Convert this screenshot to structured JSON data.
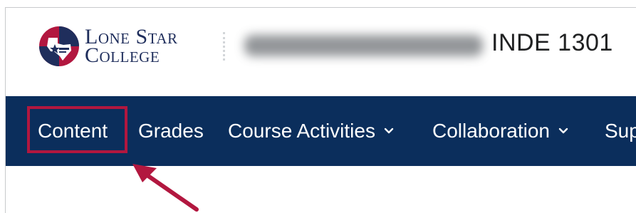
{
  "header": {
    "logo": {
      "line1": "Lone Star",
      "line2": "College",
      "mark_text": "Lone Star College"
    },
    "course_name_blurred": "",
    "course_code": "INDE 1301"
  },
  "nav": {
    "items": [
      {
        "label": "Content",
        "has_dropdown": false,
        "highlighted": true
      },
      {
        "label": "Grades",
        "has_dropdown": false
      },
      {
        "label": "Course Activities",
        "has_dropdown": true
      },
      {
        "label": "Collaboration",
        "has_dropdown": true
      },
      {
        "label": "Sup",
        "has_dropdown": false
      }
    ]
  },
  "annotation": {
    "highlight_color": "#b2173f",
    "target": "Content"
  },
  "colors": {
    "navbar": "#0b2e5c",
    "brand_blue": "#1f2e5c",
    "brand_red": "#b2173f"
  }
}
